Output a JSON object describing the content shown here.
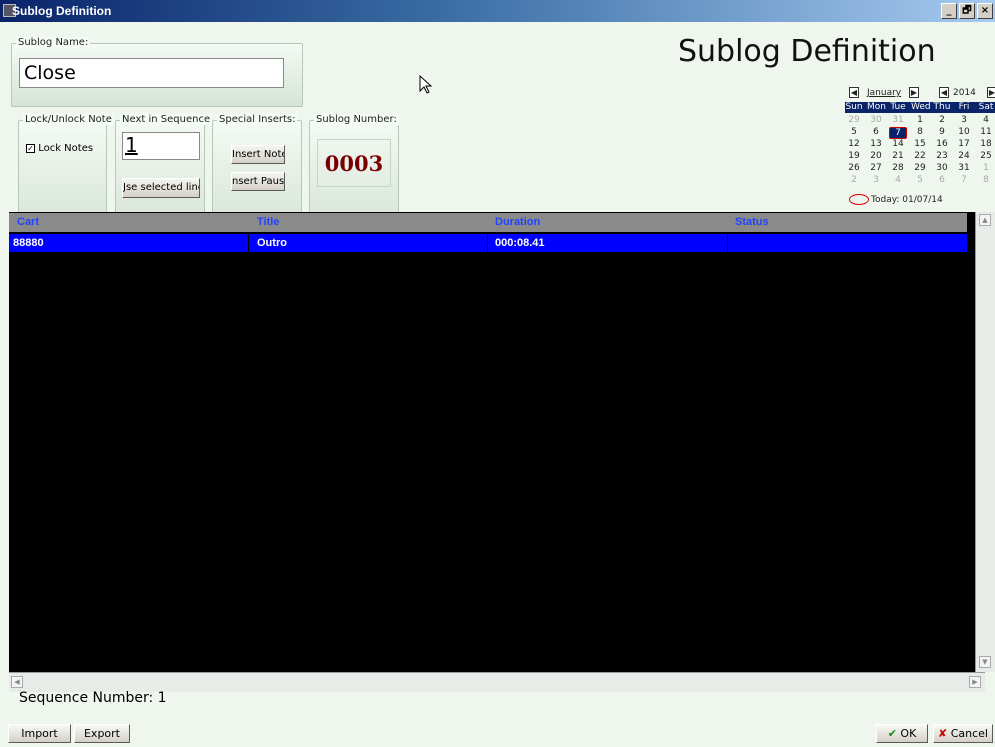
{
  "window": {
    "title": "Sublog Definition",
    "controls": [
      "_",
      "🗗",
      "×"
    ]
  },
  "page_title": "Sublog Definition",
  "sublog_name": {
    "legend": "Sublog Name:",
    "value": "Close"
  },
  "lock_unlock": {
    "legend": "Lock/Unlock Note",
    "checkbox_label": "Lock Notes",
    "checked": true
  },
  "next_in_sequence": {
    "legend": "Next in Sequence",
    "value": "1",
    "button_label": "Jse selected line"
  },
  "special_inserts": {
    "legend": "Special Inserts:",
    "insert_note_label": "Insert Note",
    "insert_pause_label": "nsert Pause"
  },
  "sublog_number": {
    "legend": "Sublog Number:",
    "value": "0003"
  },
  "calendar": {
    "month": "January",
    "year": "2014",
    "weekdays": [
      "Sun",
      "Mon",
      "Tue",
      "Wed",
      "Thu",
      "Fri",
      "Sat"
    ],
    "weeks": [
      [
        "29",
        "30",
        "31",
        "1",
        "2",
        "3",
        "4"
      ],
      [
        "5",
        "6",
        "7",
        "8",
        "9",
        "10",
        "11"
      ],
      [
        "12",
        "13",
        "14",
        "15",
        "16",
        "17",
        "18"
      ],
      [
        "19",
        "20",
        "21",
        "22",
        "23",
        "24",
        "25"
      ],
      [
        "26",
        "27",
        "28",
        "29",
        "30",
        "31",
        "1"
      ],
      [
        "2",
        "3",
        "4",
        "5",
        "6",
        "7",
        "8"
      ]
    ],
    "selected_day": "7",
    "today_label": "Today: 01/07/14"
  },
  "table": {
    "columns": [
      "Cart",
      "Title",
      "Duration",
      "Status"
    ],
    "rows": [
      {
        "cart": "88880",
        "title": "Outro",
        "duration": "000:08.41",
        "status": ""
      }
    ]
  },
  "sequence_number_label": "Sequence Number:  1",
  "buttons": {
    "import": "Import",
    "export": "Export",
    "ok": "OK",
    "cancel": "Cancel"
  },
  "colors": {
    "selection": "#0000ff",
    "sublog_number": "#7a0000",
    "header_text": "#2244ff"
  }
}
